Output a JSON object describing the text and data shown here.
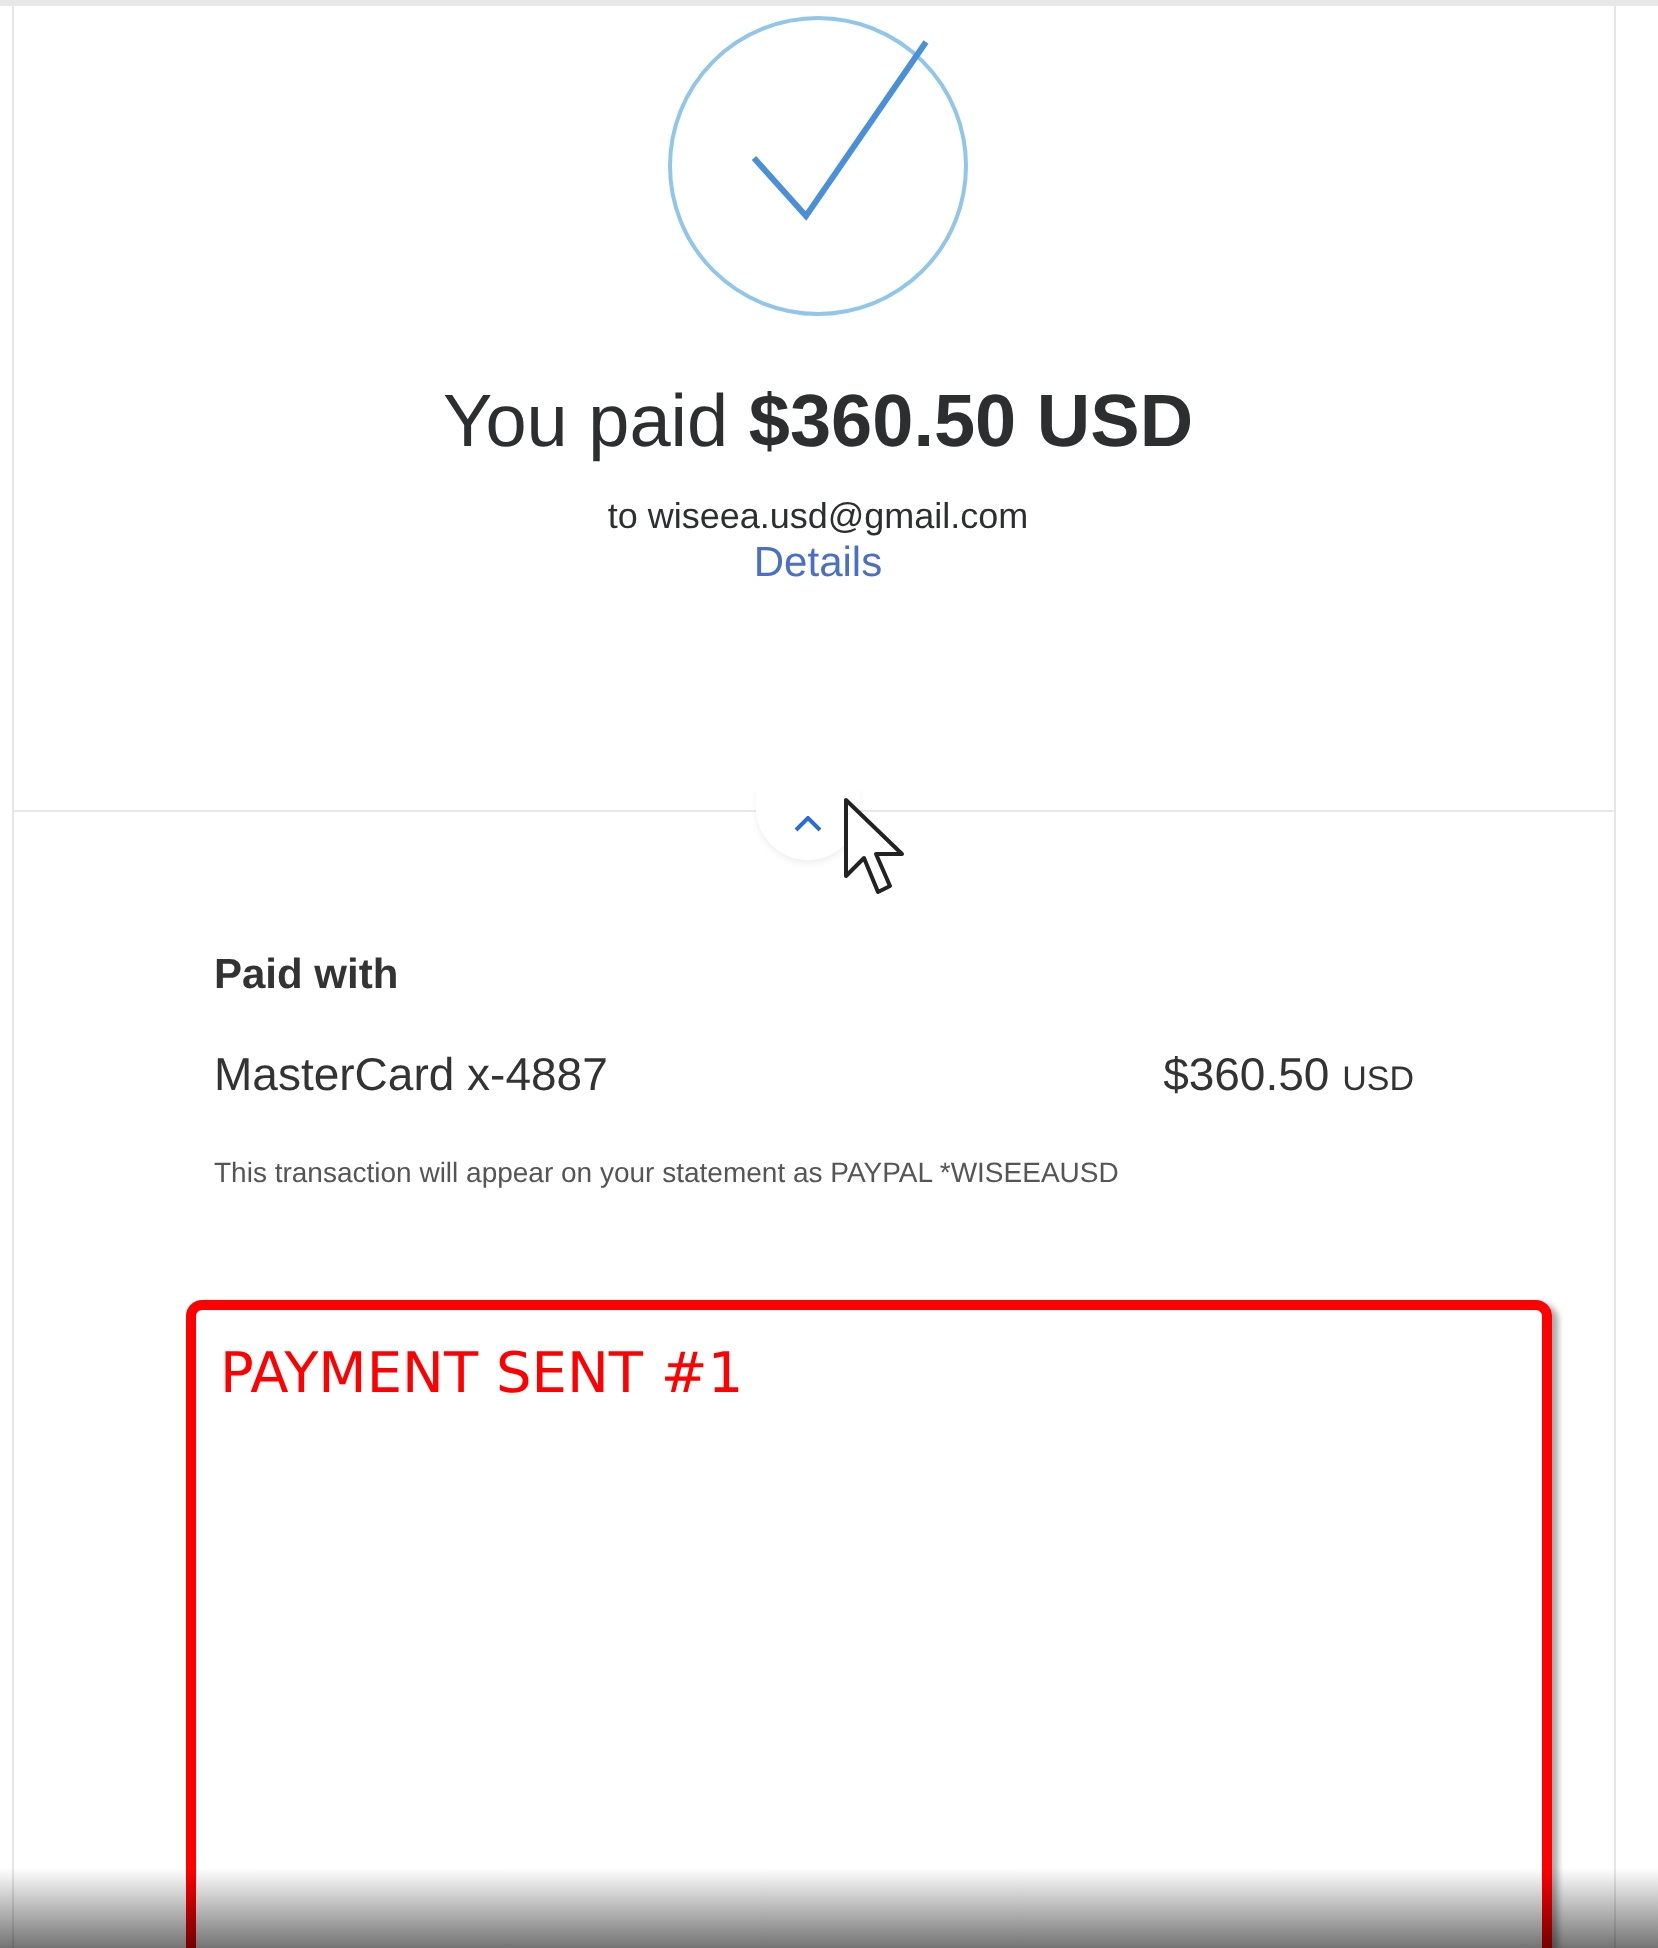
{
  "confirmation": {
    "headline": "You paid **$360.50 USD**",
    "recipient": "to wiseea.usd@gmail.com",
    "details_link": "Details"
  },
  "collapse_toggle": {
    "expanded": true
  },
  "payment_source": {
    "heading": "Paid with",
    "method": "MasterCard x-4887",
    "amount": "$360.50",
    "currency": "USD",
    "note": "This transaction will appear on your statement as PAYPAL *WISEEAUSD"
  },
  "annotation": {
    "label": "PAYMENT SENT #1"
  }
}
